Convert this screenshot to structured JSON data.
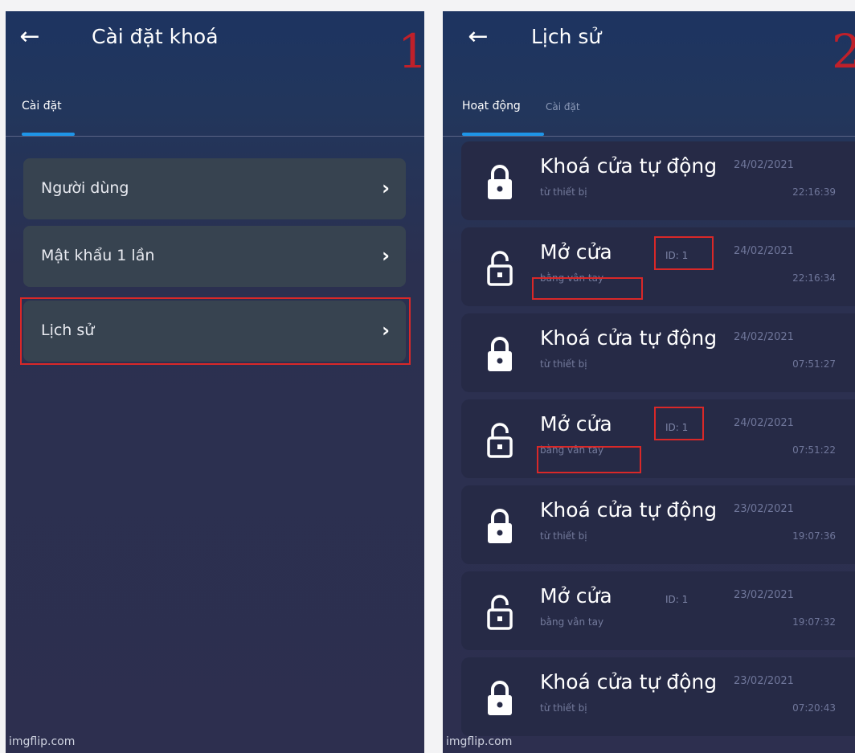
{
  "screen1": {
    "title": "Cài đặt khoá",
    "marker": "1",
    "tab": "Cài đặt",
    "menu": [
      {
        "label": "Người dùng"
      },
      {
        "label": "Mật khẩu 1 lần"
      },
      {
        "label": "Lịch sử"
      }
    ],
    "watermark": "imgflip.com"
  },
  "screen2": {
    "title": "Lịch sử",
    "marker": "2",
    "tabs": [
      {
        "label": "Hoạt động",
        "active": true
      },
      {
        "label": "Cài đặt",
        "active": false
      }
    ],
    "events": [
      {
        "title": "Khoá cửa tự động",
        "subtitle": "từ thiết bị",
        "id": "",
        "date": "24/02/2021",
        "time": "22:16:39",
        "locked": true
      },
      {
        "title": "Mở cửa",
        "subtitle": "bằng vân tay",
        "id": "ID: 1",
        "date": "24/02/2021",
        "time": "22:16:34",
        "locked": false
      },
      {
        "title": "Khoá cửa tự động",
        "subtitle": "từ thiết bị",
        "id": "",
        "date": "24/02/2021",
        "time": "07:51:27",
        "locked": true
      },
      {
        "title": "Mở cửa",
        "subtitle": "bằng vân tay",
        "id": "ID: 1",
        "date": "24/02/2021",
        "time": "07:51:22",
        "locked": false
      },
      {
        "title": "Khoá cửa tự động",
        "subtitle": "từ thiết bị",
        "id": "",
        "date": "23/02/2021",
        "time": "19:07:36",
        "locked": true
      },
      {
        "title": "Mở cửa",
        "subtitle": "bằng vân tay",
        "id": "ID: 1",
        "date": "23/02/2021",
        "time": "19:07:32",
        "locked": false
      },
      {
        "title": "Khoá cửa tự động",
        "subtitle": "từ thiết bị",
        "id": "",
        "date": "23/02/2021",
        "time": "07:20:43",
        "locked": true
      }
    ],
    "watermark": "imgflip.com"
  },
  "icons": {
    "back": "arrow-left-icon",
    "chevron": "chevron-right-icon",
    "locked": "lock-closed-icon",
    "unlocked": "lock-open-icon"
  },
  "colors": {
    "accent": "#1e95e8",
    "annotation": "#d92828"
  }
}
